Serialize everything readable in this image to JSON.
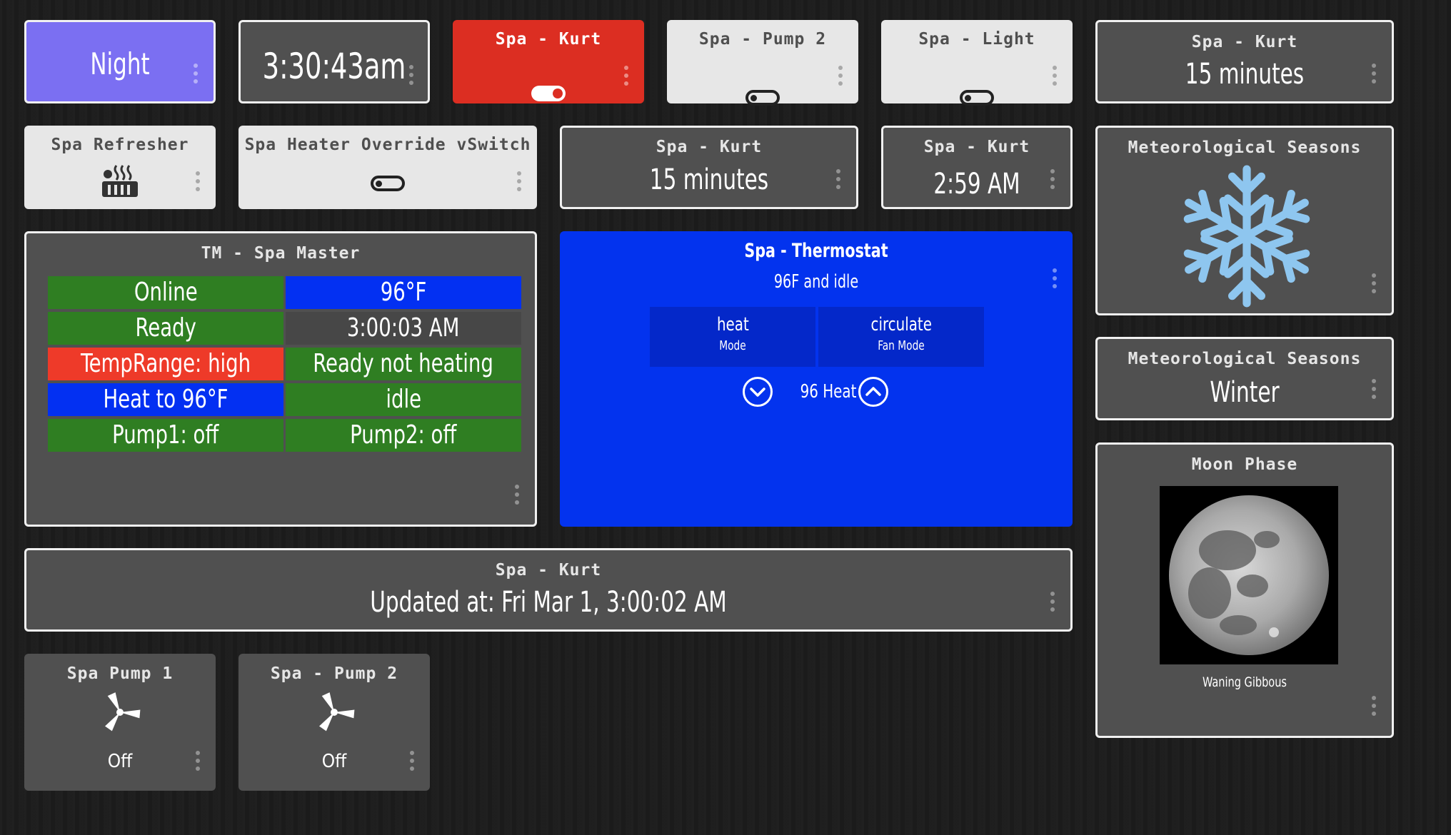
{
  "mode_tile": {
    "label": "Night"
  },
  "clock_tile": {
    "time": "3:30:43am"
  },
  "spa_kurt_switch": {
    "title": "Spa - Kurt",
    "state": "on"
  },
  "spa_pump2_switch": {
    "title": "Spa - Pump 2",
    "state": "off"
  },
  "spa_light_switch": {
    "title": "Spa - Light",
    "state": "off"
  },
  "spa_kurt_duration_top": {
    "title": "Spa - Kurt",
    "value": "15 minutes"
  },
  "spa_refresher": {
    "title": "Spa Refresher",
    "icon": "heater-icon"
  },
  "heater_override": {
    "title": "Spa Heater Override vSwitch",
    "state": "off"
  },
  "spa_kurt_duration_mid": {
    "title": "Spa - Kurt",
    "value": "15 minutes"
  },
  "spa_kurt_time": {
    "title": "Spa - Kurt",
    "value": "2:59 AM"
  },
  "seasons_icon_tile": {
    "title": "Meteorological Seasons",
    "icon": "snowflake-icon",
    "icon_color": "#8ec6ef"
  },
  "seasons_text_tile": {
    "title": "Meteorological Seasons",
    "value": "Winter"
  },
  "spa_master": {
    "title": "TM - Spa Master",
    "cells": [
      {
        "text": "Online",
        "color": "#2f7e22"
      },
      {
        "text": "96°F",
        "color": "#0330f2"
      },
      {
        "text": "Ready",
        "color": "#2f7e22"
      },
      {
        "text": "3:00:03 AM",
        "color": "#474747"
      },
      {
        "text": "TempRange: high",
        "color": "#ee3a29"
      },
      {
        "text": "Ready not heating",
        "color": "#2f7e22"
      },
      {
        "text": "Heat to 96°F",
        "color": "#0330f2"
      },
      {
        "text": "idle",
        "color": "#2f7e22"
      },
      {
        "text": "Pump1: off",
        "color": "#2f7e22"
      },
      {
        "text": "Pump2: off",
        "color": "#2f7e22"
      }
    ]
  },
  "thermostat": {
    "title": "Spa - Thermostat",
    "status": "96F and idle",
    "mode_value": "heat",
    "mode_label": "Mode",
    "fan_value": "circulate",
    "fan_label": "Fan Mode",
    "setpoint": "96 Heat",
    "color": "#0333ee"
  },
  "moon_phase": {
    "title": "Moon Phase",
    "caption": "Waning Gibbous"
  },
  "updated_tile": {
    "title": "Spa - Kurt",
    "value": "Updated at: Fri Mar 1, 3:00:02 AM"
  },
  "pump1_tile": {
    "title": "Spa Pump 1",
    "state": "Off",
    "icon": "fan-icon"
  },
  "pump2_tile": {
    "title": "Spa - Pump 2",
    "state": "Off",
    "icon": "fan-icon"
  }
}
